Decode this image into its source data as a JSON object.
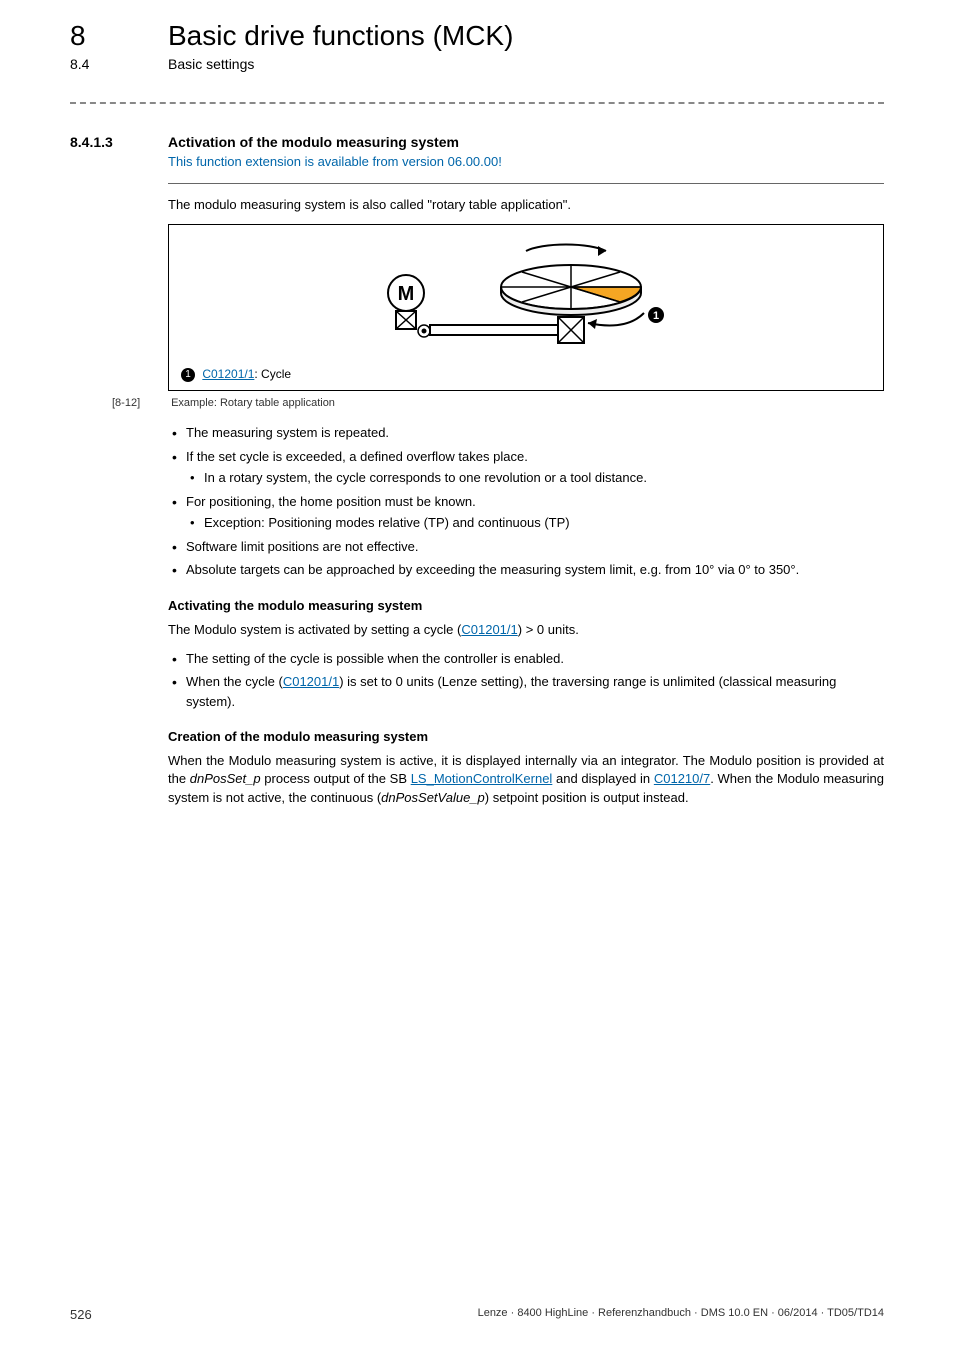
{
  "header": {
    "chapter_num": "8",
    "chapter_title": "Basic drive functions (MCK)",
    "section_num": "8.4",
    "section_title": "Basic settings"
  },
  "section": {
    "subsection_num": "8.4.1.3",
    "subsection_title": "Activation of the modulo measuring system",
    "info_text": "This function extension is available from version 06.00.00!",
    "intro_para": "The modulo measuring system is also called \"rotary table application\"."
  },
  "figure": {
    "legend_num": "1",
    "legend_link": "C01201/1",
    "legend_after": ": Cycle",
    "caption_num": "[8-12]",
    "caption_text": "Example: Rotary table application"
  },
  "bullets_main": [
    {
      "text": "The measuring system is repeated."
    },
    {
      "text": "If the set cycle is exceeded, a defined overflow takes place.",
      "sub": [
        "In a rotary system, the cycle corresponds to one revolution or a tool distance."
      ]
    },
    {
      "text": "For positioning, the home position must be known.",
      "sub": [
        "Exception: Positioning modes relative (TP) and continuous (TP)"
      ]
    },
    {
      "text": "Software limit positions are not effective."
    },
    {
      "text": "Absolute targets can be approached by exceeding the measuring system limit, e.g. from 10° via 0° to 350°."
    }
  ],
  "activating": {
    "heading": "Activating the modulo measuring system",
    "para_before": "The Modulo system is activated by setting a cycle (",
    "para_link": "C01201/1",
    "para_after": ") > 0 units.",
    "b1": "The setting of the cycle is possible when the controller is enabled.",
    "b2_before": "When the cycle (",
    "b2_link": "C01201/1",
    "b2_after": ") is set to 0 units (Lenze setting), the traversing range is unlimited (classical measuring system)."
  },
  "creation": {
    "heading": "Creation of the modulo measuring system",
    "p_before": "When the Modulo measuring system is active, it is displayed internally via an integrator. The Modulo position is provided at the ",
    "p_italic1": "dnPosSet_p",
    "p_mid1": " process output of the SB ",
    "p_link1": "LS_MotionControlKernel",
    "p_mid2": " and displayed in ",
    "p_link2": "C01210/7",
    "p_mid3": ". When the Modulo measuring system is not active, the continuous (",
    "p_italic2": "dnPosSetValue_p",
    "p_after": ") setpoint position is output instead."
  },
  "footer": {
    "page": "526",
    "text": "Lenze · 8400 HighLine · Referenzhandbuch · DMS 10.0 EN · 06/2014 · TD05/TD14"
  }
}
